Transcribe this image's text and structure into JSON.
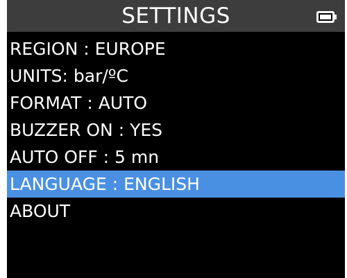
{
  "header": {
    "title": "SETTINGS",
    "battery_icon": "battery-full-icon"
  },
  "menu": {
    "selected_index": 5,
    "selected_color": "#4a90e2",
    "items": [
      {
        "label": "REGION : EUROPE"
      },
      {
        "label": "UNITS: bar/ºC"
      },
      {
        "label": "FORMAT : AUTO"
      },
      {
        "label": "BUZZER ON : YES"
      },
      {
        "label": "AUTO OFF : 5 mn"
      },
      {
        "label": "LANGUAGE : ENGLISH"
      },
      {
        "label": "ABOUT"
      }
    ]
  }
}
